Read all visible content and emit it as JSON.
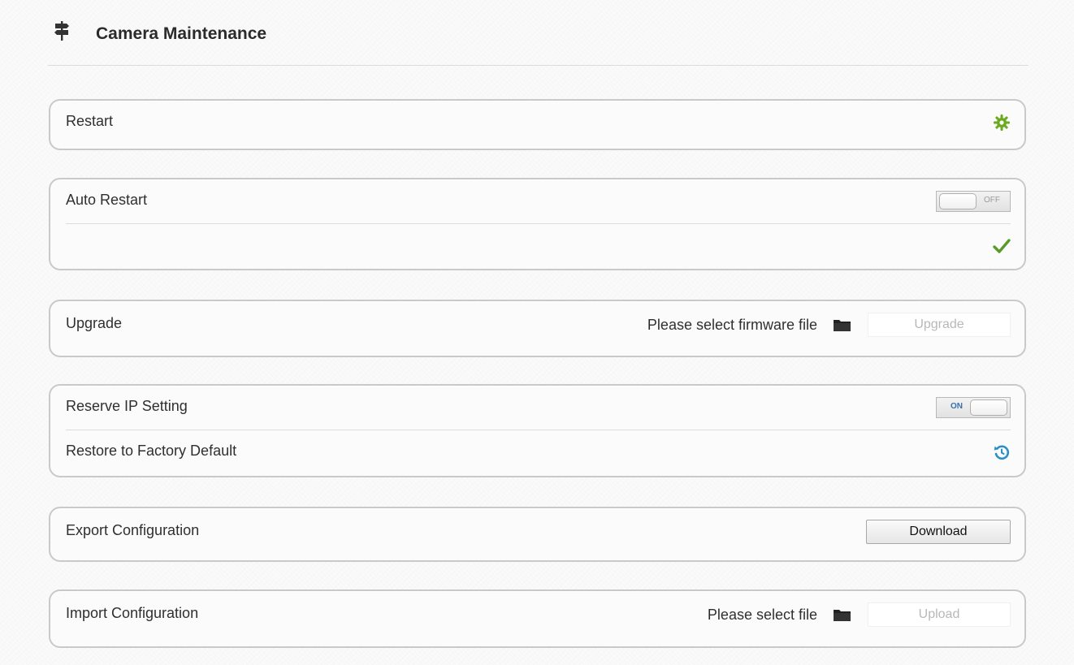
{
  "header": {
    "title": "Camera Maintenance",
    "icon": "signpost-icon"
  },
  "restart": {
    "label": "Restart",
    "icon": "restart-gear-icon",
    "icon_color": "#6aaa1e"
  },
  "auto_restart": {
    "label": "Auto Restart",
    "toggle_text": "OFF",
    "toggle_state": "off",
    "confirm_icon": "checkmark-icon",
    "confirm_color": "#5a9a2a"
  },
  "upgrade": {
    "label": "Upgrade",
    "hint": "Please select firmware file",
    "folder_icon": "folder-icon",
    "button_label": "Upgrade"
  },
  "reserve_ip": {
    "label": "Reserve IP Setting",
    "toggle_text": "ON",
    "toggle_state": "on"
  },
  "restore_default": {
    "label": "Restore to Factory Default",
    "icon": "restore-icon",
    "icon_color": "#2a8fc8"
  },
  "export_config": {
    "label": "Export Configuration",
    "button_label": "Download"
  },
  "import_config": {
    "label": "Import Configuration",
    "hint": "Please select file",
    "folder_icon": "folder-icon",
    "button_label": "Upload"
  }
}
